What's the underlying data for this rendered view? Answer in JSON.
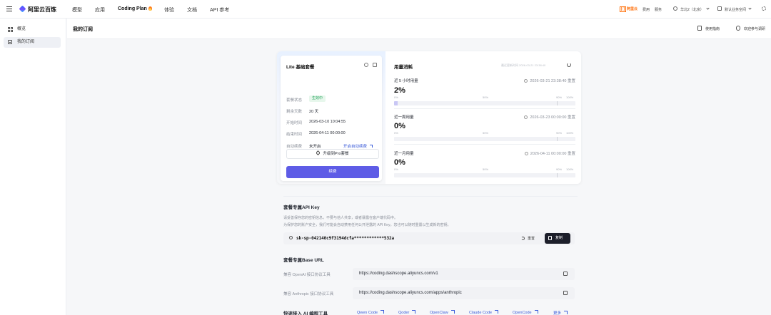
{
  "topbar": {
    "brand": "阿里云百炼",
    "nav": [
      "模型",
      "应用",
      "Coding Plan",
      "体验",
      "文档",
      "API 参考"
    ],
    "aliyun_badge": "阿里云",
    "links": [
      "费用",
      "服务"
    ],
    "region": "华北2（北京）",
    "workspace": "默认业务空间"
  },
  "sidebar": {
    "items": [
      {
        "label": "概览",
        "icon": "grid-icon"
      },
      {
        "label": "我的订阅",
        "icon": "document-icon"
      }
    ]
  },
  "page": {
    "title": "我的订阅",
    "links": [
      "使用指南",
      "欢迎参与调研"
    ]
  },
  "plan": {
    "title": "Lite 基础套餐",
    "rows": [
      {
        "label": "套餐状态",
        "value": "生效中"
      },
      {
        "label": "剩余天数",
        "value": "20 天"
      },
      {
        "label": "开始时间",
        "value": "2026-03-10 10:04:55"
      },
      {
        "label": "结束时间",
        "value": "2026-04-11 00:00:00"
      },
      {
        "label": "自动续费",
        "value": "未开启"
      }
    ],
    "auto_renew_link": "开启自动续费",
    "upgrade_label": "升级到Pro套餐",
    "renew_label": "续费"
  },
  "usage": {
    "title": "用量消耗",
    "note": "最近更新时间 2026-03-21 23:38:40",
    "ticks": [
      "0%",
      "50%",
      "90%",
      "100%"
    ],
    "items": [
      {
        "name": "近 5 小时用量",
        "pct": "2%",
        "value": 0.02,
        "reset_time": "2026-03-21 23:38:40",
        "reset_label": "重置"
      },
      {
        "name": "近一周用量",
        "pct": "0%",
        "value": 0.0,
        "reset_time": "2026-03-23 00:00:00",
        "reset_label": "重置"
      },
      {
        "name": "近一月用量",
        "pct": "0%",
        "value": 0.0,
        "reset_time": "2026-04-11 00:00:00",
        "reset_label": "重置"
      }
    ]
  },
  "apikey": {
    "title": "套餐专属API Key",
    "desc1": "请妥善保存您的密钥信息，不要与他人共享，或者暴露在客户端代码中。",
    "desc2": "为保护您的账户安全，我们可能会自动禁用任何公开泄露的 API Key。您也可以随时重置以生成新的密钥。",
    "key": "sk-sp-042140c9f3194dcfa************532a",
    "reset_label": "重置",
    "copy_label": "复制"
  },
  "baseurl": {
    "title": "套餐专属Base URL",
    "rows": [
      {
        "label": "兼容 OpenAI 接口协议工具",
        "url": "https://coding.dashscope.aliyuncs.com/v1"
      },
      {
        "label": "兼容 Anthropic 接口协议工具",
        "url": "https://coding.dashscope.aliyuncs.com/apps/anthropic"
      }
    ]
  },
  "tools": {
    "title": "快速接入 AI 编程工具",
    "items": [
      "Qwen Code",
      "Qoder",
      "OpenClaw",
      "Claude Code",
      "OpenCode",
      "更多"
    ]
  },
  "colors": {
    "accent": "#5e5ce6",
    "link": "#3a5bd9",
    "success": "#22a35a"
  }
}
